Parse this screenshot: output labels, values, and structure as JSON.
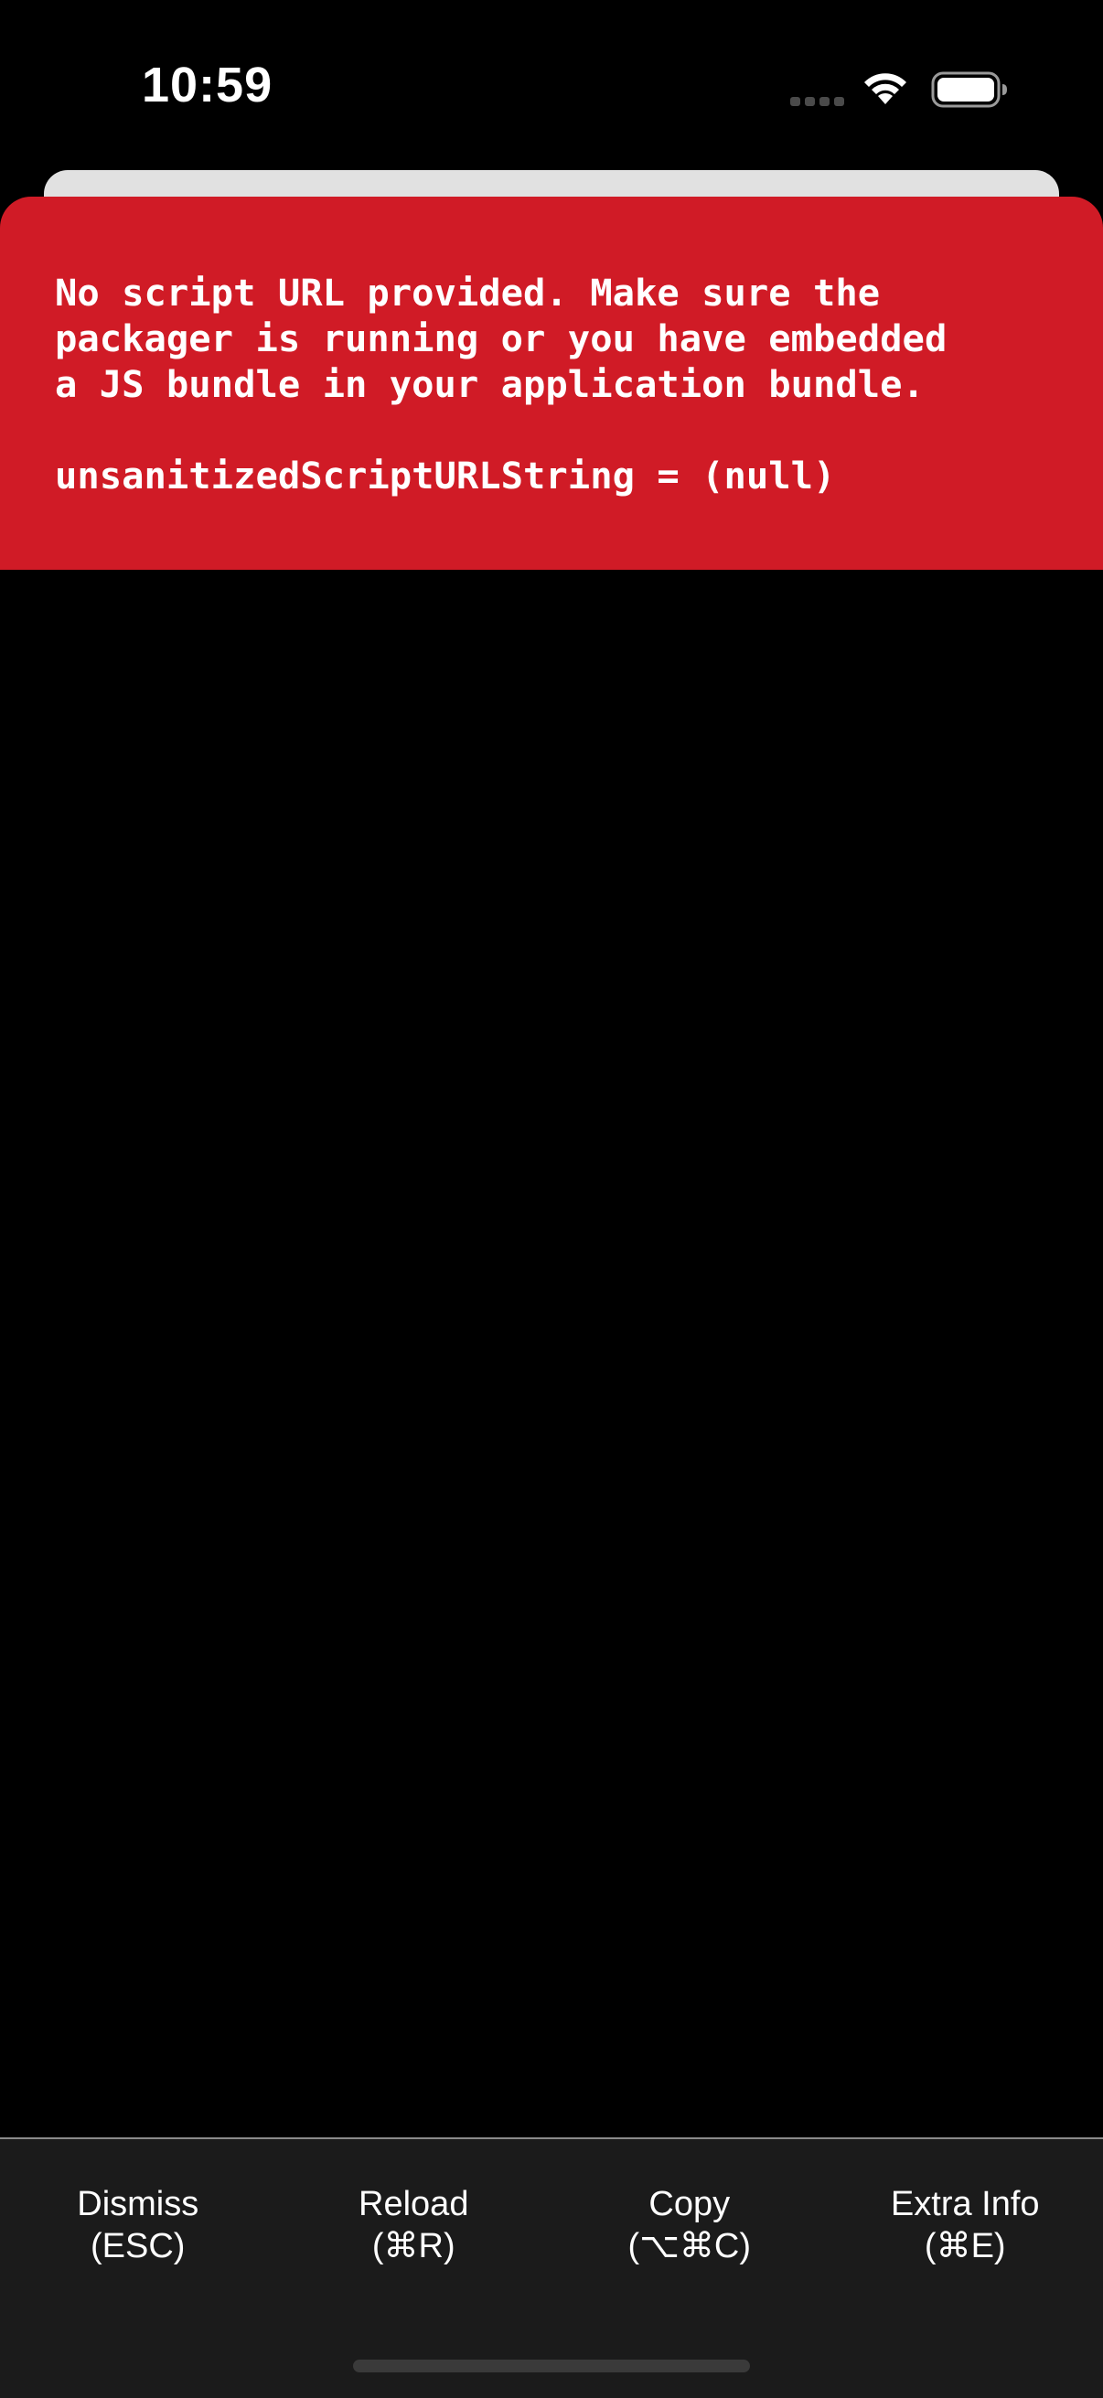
{
  "status_bar": {
    "time": "10:59",
    "icons": [
      "cellular-signal-icon",
      "wifi-icon",
      "battery-icon"
    ]
  },
  "error": {
    "message": "No script URL provided. Make sure the\npackager is running or you have embedded\na JS bundle in your application bundle.",
    "detail": "unsanitizedScriptURLString = (null)",
    "background_color": "#d01b26"
  },
  "toolbar": {
    "buttons": [
      {
        "label": "Dismiss",
        "shortcut": "(ESC)"
      },
      {
        "label": "Reload",
        "shortcut": "(⌘R)"
      },
      {
        "label": "Copy",
        "shortcut": "(⌥⌘C)"
      },
      {
        "label": "Extra Info",
        "shortcut": "(⌘E)"
      }
    ]
  }
}
